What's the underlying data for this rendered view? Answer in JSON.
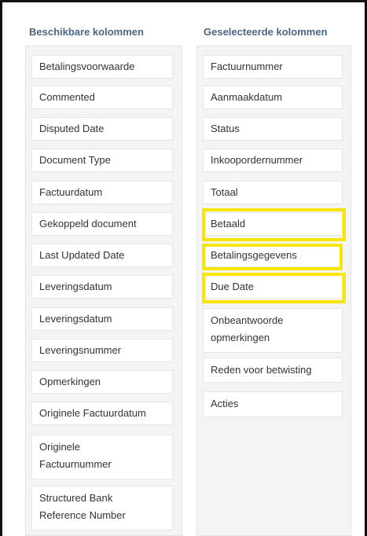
{
  "available": {
    "title": "Beschikbare kolommen",
    "items": [
      "Betalingsvoorwaarde",
      "Commented",
      "Disputed Date",
      "Document Type",
      "Factuurdatum",
      "Gekoppeld document",
      "Last Updated Date",
      "Leveringsdatum",
      "Leveringsdatum",
      "Leveringsnummer",
      "Opmerkingen",
      "Originele Factuurdatum",
      "Originele Factuurnummer",
      "Structured Bank Reference Number"
    ]
  },
  "selected": {
    "title": "Geselecteerde kolommen",
    "items": [
      "Factuurnummer",
      "Aanmaakdatum",
      "Status",
      "Inkoopordernummer",
      "Totaal",
      "Betaald",
      "Betalingsgegevens",
      "Due Date",
      "Onbeantwoorde opmerkingen",
      "Reden voor betwisting",
      "Acties"
    ],
    "highlighted": [
      "Betaald",
      "Betalingsgegevens",
      "Due Date"
    ]
  },
  "colors": {
    "highlight": "#f7e600",
    "heading": "#4a6786"
  }
}
